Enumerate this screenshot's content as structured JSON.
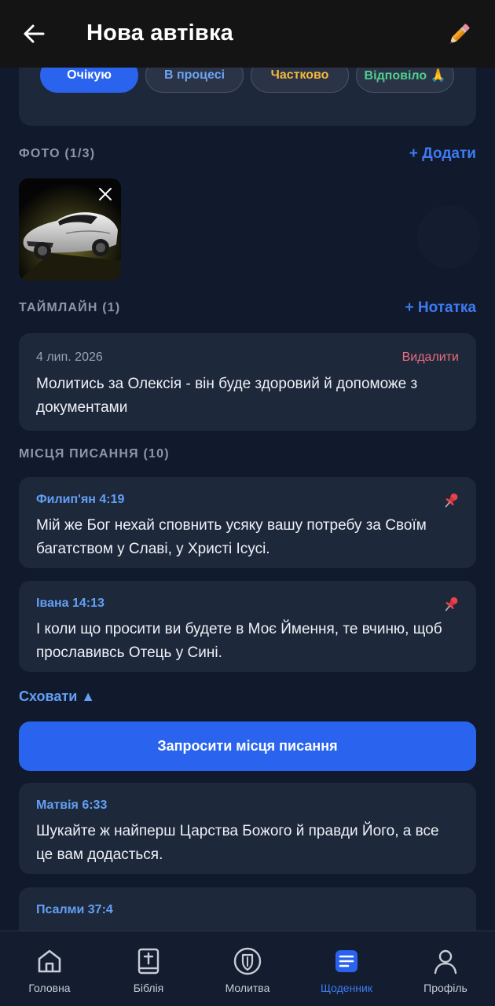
{
  "header": {
    "title": "Нова автівка",
    "back_icon": "arrow-left-icon",
    "edit_icon": "pencil-icon"
  },
  "status": {
    "chips": [
      {
        "label": "Очікую",
        "active": true,
        "color": "#ffffff"
      },
      {
        "label": "В процесі",
        "active": false,
        "color": "#6da3f3"
      },
      {
        "label": "Частково",
        "active": false,
        "color": "#f5b83a"
      },
      {
        "label": "Відповіло 🙏",
        "active": false,
        "color": "#4fcf8e"
      }
    ]
  },
  "photos": {
    "label": "ФОТО (1/3)",
    "add_label": "+ Додати"
  },
  "timeline": {
    "label": "ТАЙМЛАЙН (1)",
    "add_label": "+ Нотатка",
    "entries": [
      {
        "date": "4 лип. 2026",
        "delete_label": "Видалити",
        "text": "Молитись за Олексія - він буде здоровий й допоможе з документами"
      }
    ]
  },
  "scripture": {
    "label": "МІСЦЯ ПИСАННЯ (10)",
    "pinned": [
      {
        "ref": "Филип'ян 4:19",
        "text": "Мій же Бог нехай сповнить усяку вашу потребу за Своїм багатством у Славі, у Христі Ісусі."
      },
      {
        "ref": "Івана 14:13",
        "text": "І коли що просити ви будете в Моє Ймення, те вчиню, щоб прославивсь Отець у Сині."
      }
    ],
    "hide_label": "Сховати ▲",
    "request_label": "Запросити місця писання",
    "suggested": [
      {
        "ref": "Матвія 6:33",
        "text": "Шукайте ж найперш Царства Божого й правди Його, а все це вам додасться."
      },
      {
        "ref": "Псалми 37:4",
        "text": ""
      }
    ]
  },
  "nav": {
    "items": [
      {
        "label": "Головна",
        "icon": "home-icon",
        "active": false
      },
      {
        "label": "Біблія",
        "icon": "bible-icon",
        "active": false
      },
      {
        "label": "Молитва",
        "icon": "prayer-shield-icon",
        "active": false
      },
      {
        "label": "Щоденник",
        "icon": "journal-icon",
        "active": true
      },
      {
        "label": "Профіль",
        "icon": "profile-icon",
        "active": false
      }
    ]
  },
  "colors": {
    "accent": "#2a64ee",
    "background": "#111a2d",
    "card": "#1e283b",
    "danger": "#ea6d7d",
    "link": "#62a0f5"
  }
}
